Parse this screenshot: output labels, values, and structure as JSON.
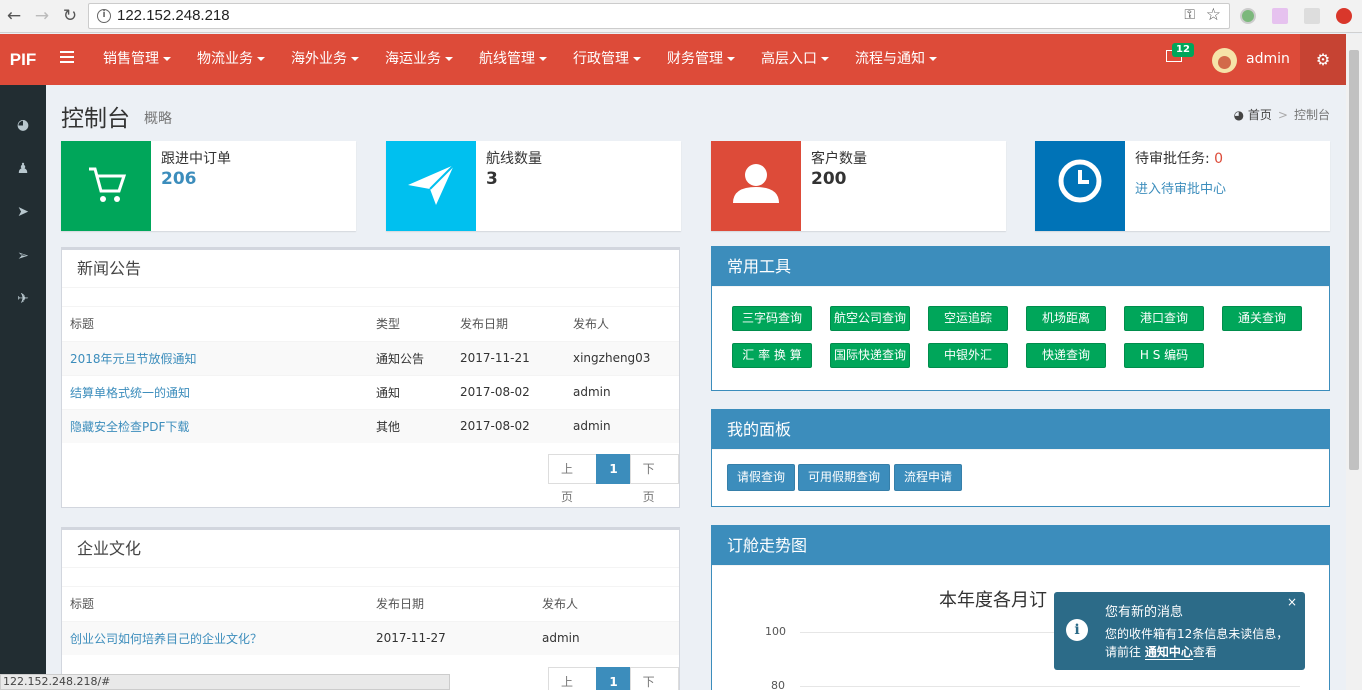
{
  "browser": {
    "url": "122.152.248.218"
  },
  "header": {
    "logo": "PIF",
    "menu": [
      {
        "label": "销售管理"
      },
      {
        "label": "物流业务"
      },
      {
        "label": "海外业务"
      },
      {
        "label": "海运业务"
      },
      {
        "label": "航线管理"
      },
      {
        "label": "行政管理"
      },
      {
        "label": "财务管理"
      },
      {
        "label": "高层入口"
      },
      {
        "label": "流程与通知"
      }
    ],
    "mail_count": "12",
    "username": "admin"
  },
  "page": {
    "title": "控制台",
    "subtitle": "概略"
  },
  "breadcrumb": {
    "home": "首页",
    "current": "控制台"
  },
  "info_boxes": [
    {
      "label": "跟进中订单",
      "value": "206",
      "color": "#00a65a"
    },
    {
      "label": "航线数量",
      "value": "3",
      "color": "#00c0ef"
    },
    {
      "label": "客户数量",
      "value": "200",
      "color": "#dd4b39"
    },
    {
      "label": "待审批任务:",
      "count": "0",
      "link": "进入待审批中心",
      "color": "#0073b7"
    }
  ],
  "news": {
    "title": "新闻公告",
    "columns": [
      "标题",
      "类型",
      "发布日期",
      "发布人"
    ],
    "rows": [
      {
        "title": "2018年元旦节放假通知",
        "type": "通知公告",
        "date": "2017-11-21",
        "author": "xingzheng03"
      },
      {
        "title": "结算单格式统一的通知",
        "type": "通知",
        "date": "2017-08-02",
        "author": "admin"
      },
      {
        "title": "隐藏安全检查PDF下载",
        "type": "其他",
        "date": "2017-08-02",
        "author": "admin"
      }
    ],
    "pager": {
      "prev": "上页",
      "page": "1",
      "next": "下页"
    }
  },
  "culture": {
    "title": "企业文化",
    "columns": [
      "标题",
      "发布日期",
      "发布人"
    ],
    "rows": [
      {
        "title": "创业公司如何培养目己的企业文化？",
        "date": "2017-11-27",
        "author": "admin"
      }
    ],
    "pager": {
      "prev": "上页",
      "page": "1",
      "next": "下页"
    }
  },
  "tools": {
    "title": "常用工具",
    "items": [
      "三字码查询",
      "航空公司查询",
      "空运追踪",
      "机场距离",
      "港口查询",
      "通关查询",
      "汇 率 换 算",
      "国际快递查询",
      "中银外汇",
      "快递查询",
      "H S 编码"
    ]
  },
  "my_panel": {
    "title": "我的面板",
    "items": [
      "请假查询",
      "可用假期查询",
      "流程申请"
    ]
  },
  "booking_chart": {
    "title": "订舱走势图",
    "chart_title_visible": "本年度各月订",
    "y_ticks": [
      "100",
      "80"
    ]
  },
  "toast": {
    "title": "您有新的消息",
    "msg_prefix": "您的收件箱有12条信息未读信息，请前往",
    "msg_link": "通知中心",
    "msg_suffix": "查看",
    "close": "×"
  },
  "status_bar": "122.152.248.218/#"
}
